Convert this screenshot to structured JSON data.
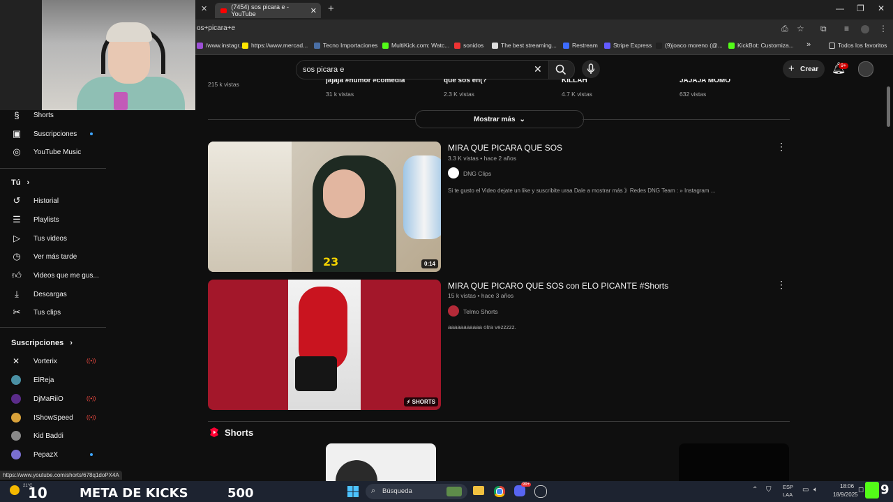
{
  "browser": {
    "tab_title": "(7454) sos picara e - YouTube",
    "url": "os+picara+e",
    "bookmarks": [
      {
        "label": "/www.instagr...",
        "color": "#9c4fd6"
      },
      {
        "label": "https://www.mercad...",
        "color": "#ffe600"
      },
      {
        "label": "Tecno Importaciones",
        "color": "#4a6fa5"
      },
      {
        "label": "MultiKick.com: Watc...",
        "color": "#53fc18"
      },
      {
        "label": "sonidos",
        "color": "#e33"
      },
      {
        "label": "The best streaming...",
        "color": "#ddd"
      },
      {
        "label": "Restream",
        "color": "#3d6cff"
      },
      {
        "label": "Stripe Express",
        "color": "#635bff"
      },
      {
        "label": "(9)joaco moreno (@...",
        "color": "#222"
      },
      {
        "label": "KickBot: Customiza...",
        "color": "#53fc18"
      }
    ],
    "all_bookmarks": "Todos los favoritos"
  },
  "header": {
    "search_value": "sos picara e",
    "create_label": "Crear",
    "notif_count": "9+"
  },
  "sidebar": {
    "top_items": [
      {
        "label": "Shorts",
        "icon": "shorts-icon"
      },
      {
        "label": "Suscripciones",
        "icon": "subscriptions-icon"
      },
      {
        "label": "YouTube Music",
        "icon": "music-icon"
      }
    ],
    "you_title": "Tú",
    "you_items": [
      {
        "label": "Historial",
        "icon": "history-icon"
      },
      {
        "label": "Playlists",
        "icon": "playlists-icon"
      },
      {
        "label": "Tus videos",
        "icon": "your-videos-icon"
      },
      {
        "label": "Ver más tarde",
        "icon": "watch-later-icon"
      },
      {
        "label": "Videos que me gus...",
        "icon": "like-icon"
      },
      {
        "label": "Descargas",
        "icon": "download-icon"
      },
      {
        "label": "Tus clips",
        "icon": "clips-icon"
      }
    ],
    "subs_title": "Suscripciones",
    "subs": [
      {
        "label": "Vorterix",
        "color": "#111"
      },
      {
        "label": "ElReja",
        "color": "#4a90a4"
      },
      {
        "label": "DjMaRiiO",
        "color": "#5b2c8a"
      },
      {
        "label": "IShowSpeed",
        "color": "#d9a23a"
      },
      {
        "label": "Kid Baddi",
        "color": "#888"
      },
      {
        "label": "PepazX",
        "color": "#7a6fd0"
      }
    ]
  },
  "prev_row": {
    "items": [
      {
        "title": "",
        "views": "215 k vistas"
      },
      {
        "title": "jajaja #humor #comedia",
        "views": "31 k vistas"
      },
      {
        "title": "que sos en(?",
        "views": "2.3 K vistas"
      },
      {
        "title": "KILLAH",
        "views": "4.7 K vistas"
      },
      {
        "title": "JAJAJA MOMO",
        "views": "632 vistas"
      }
    ]
  },
  "show_more": "Mostrar más",
  "results": [
    {
      "title": "MIRA QUE PICARA QUE SOS",
      "meta": "3.3 K vistas • hace 2 años",
      "channel": "DNG Clips",
      "desc": "Si te gusto el Video dejate un like y suscribite uraa Dale a mostrar más 》Redes DNG Team : » Instagram ...",
      "duration": "0:14",
      "number": "23"
    },
    {
      "title": "MIRA QUE PICARO QUE SOS con ELO PICANTE #Shorts",
      "meta": "15 k vistas • hace 3 años",
      "channel": "Telmo Shorts",
      "desc": "aaaaaaaaaaa otra vezzzzz.",
      "duration": "SHORTS"
    }
  ],
  "shorts_title": "Shorts",
  "status_url": "https://www.youtube.com/shorts/678q1doPX4A",
  "taskbar": {
    "temp": "21°C",
    "left_num": "10",
    "meta": "META DE KICKS",
    "goal": "500",
    "search_label": "Búsqueda",
    "lang1": "ESP",
    "lang2": "LAA",
    "time": "18:06",
    "date": "18/9/2025",
    "kick_num": "9",
    "chrome_badge": "",
    "discord_badge": "99+"
  }
}
